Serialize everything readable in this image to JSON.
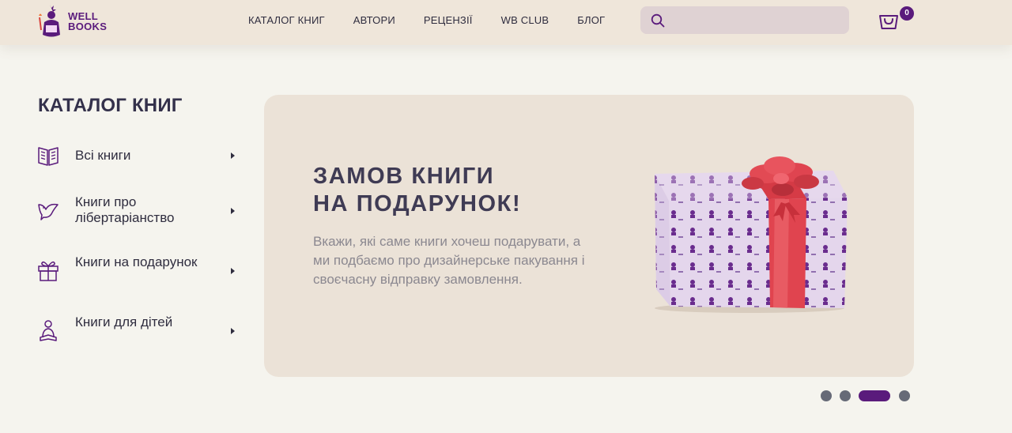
{
  "header": {
    "logo_line1": "WELL",
    "logo_line2": "BOOKS",
    "nav": [
      "КАТАЛОГ КНИГ",
      "АВТОРИ",
      "РЕЦЕНЗІЇ",
      "WB CLUB",
      "БЛОГ"
    ],
    "search_value": "",
    "cart_count": "0"
  },
  "catalog": {
    "title": "КАТАЛОГ КНИГ",
    "items": [
      {
        "label": "Всі книги",
        "icon": "open-book-icon"
      },
      {
        "label": "Книги про лібертаріанство",
        "icon": "dove-icon"
      },
      {
        "label": "Книги на подарунок",
        "icon": "gift-icon"
      },
      {
        "label": "Книги для дітей",
        "icon": "child-reading-icon"
      }
    ]
  },
  "banner": {
    "title_line1": "ЗАМОВ КНИГИ",
    "title_line2": "НА ПОДАРУНОК!",
    "text": "Вкажи, які саме книги хочеш подарувати, а ми подбаємо про дизайнерське пакування і своєчасну відправку замовлення.",
    "image": "gift-box-icon"
  },
  "carousel": {
    "slide_count": 4,
    "active_index": 2
  },
  "colors": {
    "brand": "#5a1b7c",
    "header_bg": "#efe6da",
    "page_bg": "#f5f4ee",
    "banner_bg": "#ebe2d7",
    "ribbon": "#e0444f",
    "dot_inactive": "#666a77"
  }
}
